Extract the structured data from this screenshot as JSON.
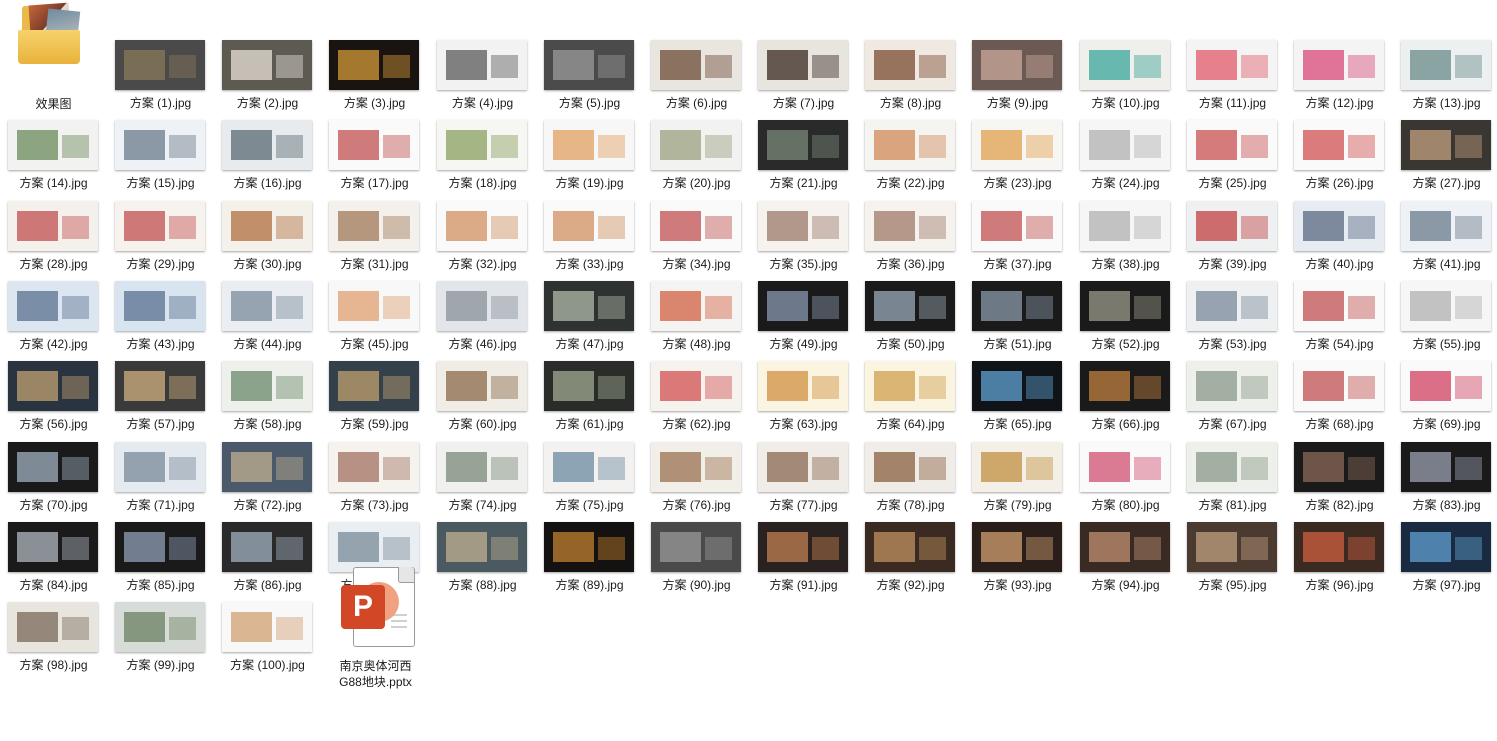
{
  "folder": {
    "label": "效果图"
  },
  "pptx": {
    "label": "南京奥体河西G88地块.pptx",
    "badge": "P"
  },
  "files": [
    {
      "label": "方案 (1).jpg",
      "bg": "#4a4a4a",
      "fg": "#8a7a5a"
    },
    {
      "label": "方案 (2).jpg",
      "bg": "#5d5a52",
      "fg": "#e8e2d8"
    },
    {
      "label": "方案 (3).jpg",
      "bg": "#1a1410",
      "fg": "#d49a3a"
    },
    {
      "label": "方案 (4).jpg",
      "bg": "#f2f2f2",
      "fg": "#5a5a5a"
    },
    {
      "label": "方案 (5).jpg",
      "bg": "#4b4b4b",
      "fg": "#9a9a9a"
    },
    {
      "label": "方案 (6).jpg",
      "bg": "#e9e6e0",
      "fg": "#6b4a34"
    },
    {
      "label": "方案 (7).jpg",
      "bg": "#e8e4de",
      "fg": "#3a2a22"
    },
    {
      "label": "方案 (8).jpg",
      "bg": "#efe9e2",
      "fg": "#7a4a30"
    },
    {
      "label": "方案 (9).jpg",
      "bg": "#6b5a54",
      "fg": "#c9a89a"
    },
    {
      "label": "方案 (10).jpg",
      "bg": "#f0efec",
      "fg": "#3aa59a"
    },
    {
      "label": "方案 (11).jpg",
      "bg": "#f4f4f4",
      "fg": "#e05a6a"
    },
    {
      "label": "方案 (12).jpg",
      "bg": "#f4f4f4",
      "fg": "#d84a7a"
    },
    {
      "label": "方案 (13).jpg",
      "bg": "#ecf0f0",
      "fg": "#6a8a8a"
    },
    {
      "label": "方案 (14).jpg",
      "bg": "#f2f2f0",
      "fg": "#6a8a5a"
    },
    {
      "label": "方案 (15).jpg",
      "bg": "#eef2f6",
      "fg": "#6a7a8a"
    },
    {
      "label": "方案 (16).jpg",
      "bg": "#e8ebee",
      "fg": "#5a6a72"
    },
    {
      "label": "方案 (17).jpg",
      "bg": "#fafafa",
      "fg": "#c05050"
    },
    {
      "label": "方案 (18).jpg",
      "bg": "#f6f6f2",
      "fg": "#8aa060"
    },
    {
      "label": "方案 (19).jpg",
      "bg": "#f7f7f7",
      "fg": "#e0a060"
    },
    {
      "label": "方案 (20).jpg",
      "bg": "#f2f2f0",
      "fg": "#9aa080"
    },
    {
      "label": "方案 (21).jpg",
      "bg": "#2a2a2a",
      "fg": "#7a8a7a"
    },
    {
      "label": "方案 (22).jpg",
      "bg": "#f6f4f0",
      "fg": "#d08a5a"
    },
    {
      "label": "方案 (23).jpg",
      "bg": "#f7f6f2",
      "fg": "#e0a050"
    },
    {
      "label": "方案 (24).jpg",
      "bg": "#f6f6f6",
      "fg": "#b0b0b0"
    },
    {
      "label": "方案 (25).jpg",
      "bg": "#fafafa",
      "fg": "#c85050"
    },
    {
      "label": "方案 (26).jpg",
      "bg": "#fafafa",
      "fg": "#d05050"
    },
    {
      "label": "方案 (27).jpg",
      "bg": "#3a3632",
      "fg": "#c0a080"
    },
    {
      "label": "方案 (28).jpg",
      "bg": "#f4f0ec",
      "fg": "#c05050"
    },
    {
      "label": "方案 (29).jpg",
      "bg": "#f6f2ee",
      "fg": "#c05050"
    },
    {
      "label": "方案 (30).jpg",
      "bg": "#f4f0ea",
      "fg": "#b07040"
    },
    {
      "label": "方案 (31).jpg",
      "bg": "#f4f0ec",
      "fg": "#a07a5a"
    },
    {
      "label": "方案 (32).jpg",
      "bg": "#fafafa",
      "fg": "#d09060"
    },
    {
      "label": "方案 (33).jpg",
      "bg": "#fafafa",
      "fg": "#d09060"
    },
    {
      "label": "方案 (34).jpg",
      "bg": "#fafafa",
      "fg": "#c05050"
    },
    {
      "label": "方案 (35).jpg",
      "bg": "#f6f2ee",
      "fg": "#9a7a6a"
    },
    {
      "label": "方案 (36).jpg",
      "bg": "#f6f2ee",
      "fg": "#a07a6a"
    },
    {
      "label": "方案 (37).jpg",
      "bg": "#fafafa",
      "fg": "#c05050"
    },
    {
      "label": "方案 (38).jpg",
      "bg": "#f6f6f6",
      "fg": "#b0b0b0"
    },
    {
      "label": "方案 (39).jpg",
      "bg": "#eef0f2",
      "fg": "#c04040"
    },
    {
      "label": "方案 (40).jpg",
      "bg": "#e6ecf2",
      "fg": "#5a6a80"
    },
    {
      "label": "方案 (41).jpg",
      "bg": "#eef2f6",
      "fg": "#6a7a8a"
    },
    {
      "label": "方案 (42).jpg",
      "bg": "#dce6f0",
      "fg": "#5a7090"
    },
    {
      "label": "方案 (43).jpg",
      "bg": "#d8e4f0",
      "fg": "#5a7090"
    },
    {
      "label": "方案 (44).jpg",
      "bg": "#eaeef2",
      "fg": "#7a8a9a"
    },
    {
      "label": "方案 (45).jpg",
      "bg": "#f8f8f8",
      "fg": "#e0a070"
    },
    {
      "label": "方案 (46).jpg",
      "bg": "#e2e6ea",
      "fg": "#8a9098"
    },
    {
      "label": "方案 (47).jpg",
      "bg": "#2e3230",
      "fg": "#b0b8a8"
    },
    {
      "label": "方案 (48).jpg",
      "bg": "#f6f4f2",
      "fg": "#d06040"
    },
    {
      "label": "方案 (49).jpg",
      "bg": "#1a1a1a",
      "fg": "#8a9ab0"
    },
    {
      "label": "方案 (50).jpg",
      "bg": "#1a1a1a",
      "fg": "#9aaab8"
    },
    {
      "label": "方案 (51).jpg",
      "bg": "#1a1a1a",
      "fg": "#8a9aa8"
    },
    {
      "label": "方案 (52).jpg",
      "bg": "#1a1a1a",
      "fg": "#9a9a8a"
    },
    {
      "label": "方案 (53).jpg",
      "bg": "#eef0f2",
      "fg": "#7a8a9a"
    },
    {
      "label": "方案 (54).jpg",
      "bg": "#fafafa",
      "fg": "#c05050"
    },
    {
      "label": "方案 (55).jpg",
      "bg": "#f6f6f6",
      "fg": "#b0b0b0"
    },
    {
      "label": "方案 (56).jpg",
      "bg": "#2a3440",
      "fg": "#c0a070"
    },
    {
      "label": "方案 (57).jpg",
      "bg": "#3a3a3a",
      "fg": "#d0b080"
    },
    {
      "label": "方案 (58).jpg",
      "bg": "#eef0ec",
      "fg": "#6a8a6a"
    },
    {
      "label": "方案 (59).jpg",
      "bg": "#34404a",
      "fg": "#c0a070"
    },
    {
      "label": "方案 (60).jpg",
      "bg": "#f0ece6",
      "fg": "#8a6a4a"
    },
    {
      "label": "方案 (61).jpg",
      "bg": "#2a2c2a",
      "fg": "#a0a890"
    },
    {
      "label": "方案 (62).jpg",
      "bg": "#f6f2ee",
      "fg": "#d05050"
    },
    {
      "label": "方案 (63).jpg",
      "bg": "#faf4e0",
      "fg": "#d09040"
    },
    {
      "label": "方案 (64).jpg",
      "bg": "#faf4e0",
      "fg": "#d0a050"
    },
    {
      "label": "方案 (65).jpg",
      "bg": "#101418",
      "fg": "#60a0d0"
    },
    {
      "label": "方案 (66).jpg",
      "bg": "#1a1a1a",
      "fg": "#c08040"
    },
    {
      "label": "方案 (67).jpg",
      "bg": "#eef0ec",
      "fg": "#8a9a8a"
    },
    {
      "label": "方案 (68).jpg",
      "bg": "#fafafa",
      "fg": "#c05050"
    },
    {
      "label": "方案 (69).jpg",
      "bg": "#fafafa",
      "fg": "#d04060"
    },
    {
      "label": "方案 (70).jpg",
      "bg": "#1a1a1a",
      "fg": "#a0b0c0"
    },
    {
      "label": "方案 (71).jpg",
      "bg": "#e4eaf0",
      "fg": "#7a8a9a"
    },
    {
      "label": "方案 (72).jpg",
      "bg": "#4a5a6a",
      "fg": "#c0b090"
    },
    {
      "label": "方案 (73).jpg",
      "bg": "#f6f2ee",
      "fg": "#a07060"
    },
    {
      "label": "方案 (74).jpg",
      "bg": "#f0f0ee",
      "fg": "#7a8a7a"
    },
    {
      "label": "方案 (75).jpg",
      "bg": "#f4f2f0",
      "fg": "#6a8aa0"
    },
    {
      "label": "方案 (76).jpg",
      "bg": "#f2eee8",
      "fg": "#9a7050"
    },
    {
      "label": "方案 (77).jpg",
      "bg": "#f0ece8",
      "fg": "#8a6a50"
    },
    {
      "label": "方案 (78).jpg",
      "bg": "#f0ece8",
      "fg": "#8a6040"
    },
    {
      "label": "方案 (79).jpg",
      "bg": "#f4f0e8",
      "fg": "#c09040"
    },
    {
      "label": "方案 (80).jpg",
      "bg": "#fafafa",
      "fg": "#d05070"
    },
    {
      "label": "方案 (81).jpg",
      "bg": "#eef0ec",
      "fg": "#8a9a8a"
    },
    {
      "label": "方案 (82).jpg",
      "bg": "#1a1a1a",
      "fg": "#8a6a5a"
    },
    {
      "label": "方案 (83).jpg",
      "bg": "#1a1a1a",
      "fg": "#9aa0b0"
    },
    {
      "label": "方案 (84).jpg",
      "bg": "#1a1a1a",
      "fg": "#b0b8c0"
    },
    {
      "label": "方案 (85).jpg",
      "bg": "#1a1a1a",
      "fg": "#90a0b8"
    },
    {
      "label": "方案 (86).jpg",
      "bg": "#2a2a2a",
      "fg": "#a0b0c0"
    },
    {
      "label": "方案 (87).jpg",
      "bg": "#e8eef2",
      "fg": "#7a8a98"
    },
    {
      "label": "方案 (88).jpg",
      "bg": "#4a5a60",
      "fg": "#c0b090"
    },
    {
      "label": "方案 (89).jpg",
      "bg": "#141210",
      "fg": "#c08030"
    },
    {
      "label": "方案 (90).jpg",
      "bg": "#4a4a4a",
      "fg": "#9a9a9a"
    },
    {
      "label": "方案 (91).jpg",
      "bg": "#2a2220",
      "fg": "#c08050"
    },
    {
      "label": "方案 (92).jpg",
      "bg": "#3a2a22",
      "fg": "#c09060"
    },
    {
      "label": "方案 (93).jpg",
      "bg": "#2a1e1a",
      "fg": "#d0a070"
    },
    {
      "label": "方案 (94).jpg",
      "bg": "#3a2a24",
      "fg": "#c09070"
    },
    {
      "label": "方案 (95).jpg",
      "bg": "#4a3a30",
      "fg": "#c0a080"
    },
    {
      "label": "方案 (96).jpg",
      "bg": "#3a2a22",
      "fg": "#d06040"
    },
    {
      "label": "方案 (97).jpg",
      "bg": "#1a2a40",
      "fg": "#60a0d0"
    },
    {
      "label": "方案 (98).jpg",
      "bg": "#e8e4de",
      "fg": "#7a6a5a"
    },
    {
      "label": "方案 (99).jpg",
      "bg": "#d8dcd8",
      "fg": "#6a8060"
    },
    {
      "label": "方案 (100).jpg",
      "bg": "#f8f8f8",
      "fg": "#d0a070"
    }
  ]
}
